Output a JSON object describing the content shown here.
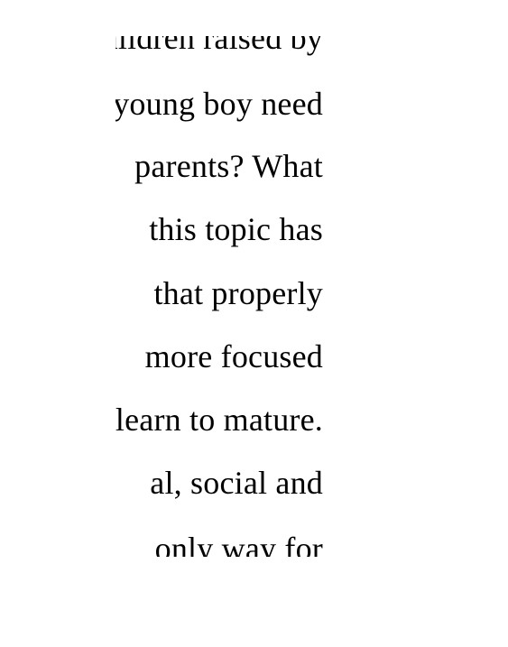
{
  "document": {
    "lines": [
      "children raised by",
      "young boy need",
      "parents? What",
      "this topic has",
      "that properly",
      "more focused",
      "learn to mature.",
      "al, social and",
      "only way for"
    ]
  }
}
